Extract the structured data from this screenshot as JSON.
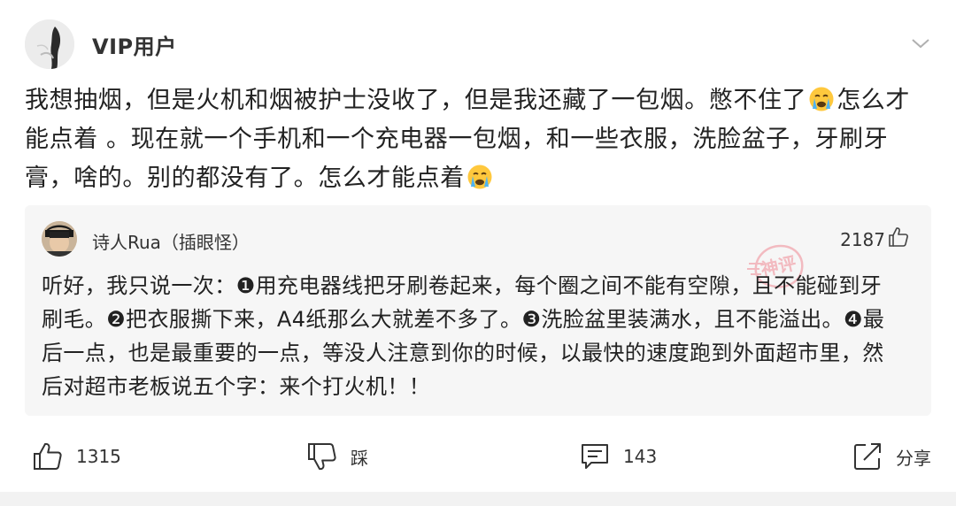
{
  "header": {
    "username": "VIP用户",
    "avatar_icon": "avatar",
    "menu_icon": "chevron-down-icon"
  },
  "post": {
    "line1_a": "我想抽烟，但是火机和烟被护士没收了，但是我还藏了一包烟。憋不住了",
    "line1_b": "怎么才",
    "line2": "能点着 。现在就一个手机和一个充电器一包烟，和一些衣服，洗脸盆子，牙刷牙",
    "line3": "膏，啥的。别的都没有了。怎么才能点着",
    "emoji_icon": "crying-face-emoji"
  },
  "comment": {
    "author": "诗人Rua（插眼怪）",
    "likes": "2187",
    "stamp_text": "神评",
    "lines": [
      "听好，我只说一次：❶用充电器线把牙刷卷起来，每个圈之间不能有空隙，且不能碰到牙",
      "刷毛。❷把衣服撕下来，A4纸那么大就差不多了。❸洗脸盆里装满水，且不能溢出。❹最",
      "后一点，也是最重要的一点，等没人注意到你的时候，以最快的速度跑到外面超市里，然",
      "后对超市老板说五个字：来个打火机！！"
    ]
  },
  "actions": {
    "like_count": "1315",
    "dislike_label": "踩",
    "comment_count": "143",
    "share_label": "分享"
  },
  "colors": {
    "text": "#222222",
    "comment_bg": "#f6f6f6",
    "stamp": "#f08a94"
  }
}
